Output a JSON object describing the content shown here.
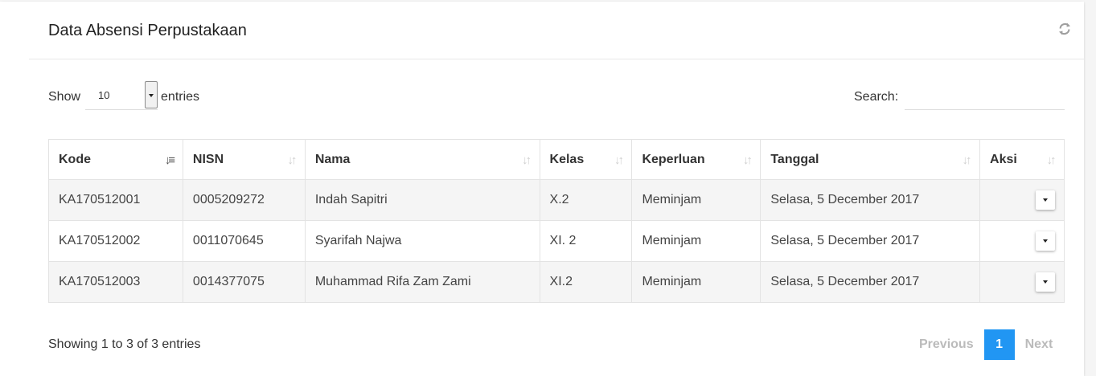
{
  "panel": {
    "title": "Data Absensi Perpustakaan",
    "refresh_icon": "refresh-icon"
  },
  "length": {
    "show_label": "Show",
    "value": "10",
    "entries_label": "entries"
  },
  "search": {
    "label": "Search:",
    "value": "",
    "placeholder": ""
  },
  "table": {
    "columns": [
      "Kode",
      "NISN",
      "Nama",
      "Kelas",
      "Keperluan",
      "Tanggal",
      "Aksi"
    ],
    "sorted_column": "Kode",
    "rows": [
      [
        "KA170512001",
        "0005209272",
        "Indah Sapitri",
        "X.2",
        "Meminjam",
        "Selasa, 5 December 2017"
      ],
      [
        "KA170512002",
        "0011070645",
        "Syarifah Najwa",
        "XI. 2",
        "Meminjam",
        "Selasa, 5 December 2017"
      ],
      [
        "KA170512003",
        "0014377075",
        "Muhammad Rifa Zam Zami",
        "XI.2",
        "Meminjam",
        "Selasa, 5 December 2017"
      ]
    ]
  },
  "footer": {
    "info": "Showing 1 to 3 of 3 entries",
    "previous": "Previous",
    "current_page": "1",
    "next": "Next",
    "accent_color": "#2196f3"
  }
}
